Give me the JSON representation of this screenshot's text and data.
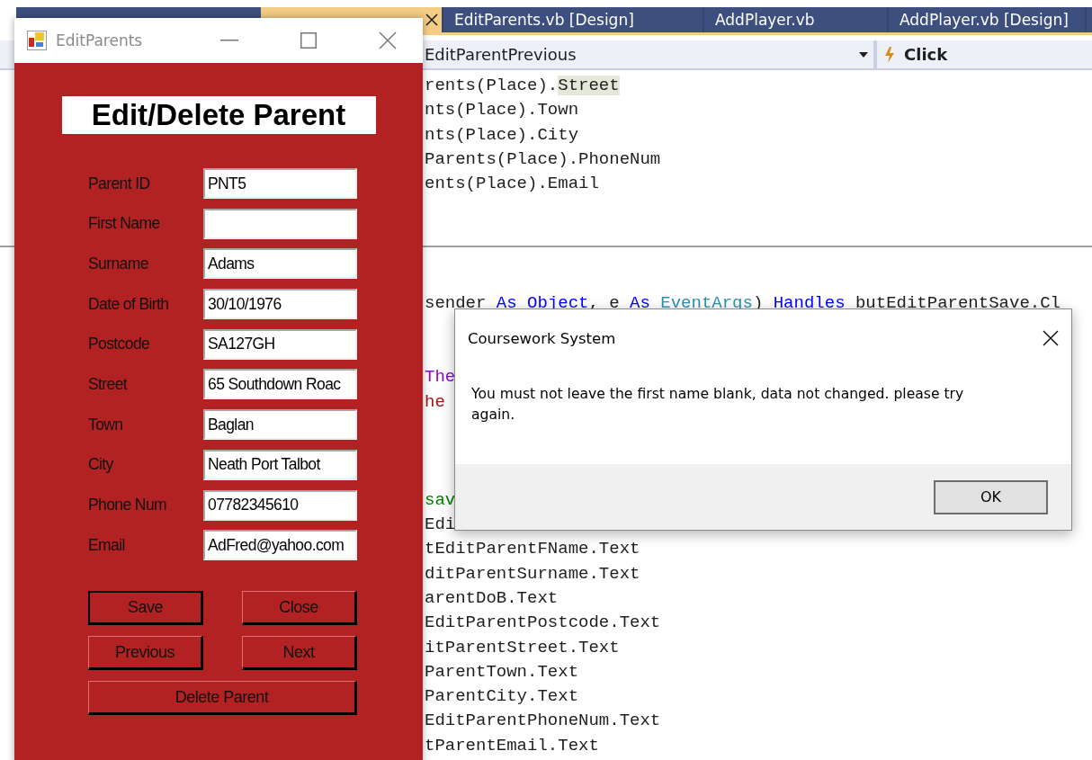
{
  "ide": {
    "tabs": [
      {
        "selected": true
      },
      {
        "label": "EditParents.vb [Design]",
        "selected": false
      },
      {
        "label": "AddPlayer.vb",
        "selected": false
      },
      {
        "label": "AddPlayer.vb [Design]",
        "selected": false
      }
    ],
    "member_dropdown": "EditParentPrevious",
    "event_dropdown": "Click",
    "code_sections": [
      {
        "lines": [
          {
            "kind": "code",
            "tokens": [
              {
                "text": "rents(Place).",
                "kind": "plain"
              },
              {
                "text": "Street",
                "kind": "highlight"
              }
            ]
          },
          {
            "kind": "code",
            "tokens": [
              {
                "text": "nts(Place).Town",
                "kind": "plain"
              }
            ]
          },
          {
            "kind": "code",
            "tokens": [
              {
                "text": "nts(Place).City",
                "kind": "plain"
              }
            ]
          },
          {
            "kind": "code",
            "tokens": [
              {
                "text": "Parents(Place).PhoneNum",
                "kind": "plain"
              }
            ]
          },
          {
            "kind": "code",
            "tokens": [
              {
                "text": "ents(Place).Email",
                "kind": "plain"
              }
            ]
          },
          {
            "kind": "blank"
          },
          {
            "kind": "blank"
          }
        ]
      },
      {
        "lines": [
          {
            "kind": "blank"
          },
          {
            "kind": "code",
            "tokens": [
              {
                "text": "sender ",
                "kind": "plain"
              },
              {
                "text": "As Object",
                "kind": "keyword"
              },
              {
                "text": ", e ",
                "kind": "plain"
              },
              {
                "text": "As ",
                "kind": "keyword"
              },
              {
                "text": "EventArgs",
                "kind": "type"
              },
              {
                "text": ") ",
                "kind": "plain"
              },
              {
                "text": "Handles",
                "kind": "keyword"
              },
              {
                "text": " butEditParentSave.Cl",
                "kind": "plain"
              }
            ]
          },
          {
            "kind": "blank"
          },
          {
            "kind": "blank"
          },
          {
            "kind": "code",
            "tokens": [
              {
                "text": "The",
                "kind": "control"
              }
            ]
          },
          {
            "kind": "code",
            "tokens": [
              {
                "text": "he",
                "kind": "string"
              }
            ]
          },
          {
            "kind": "blank"
          },
          {
            "kind": "blank"
          },
          {
            "kind": "blank"
          },
          {
            "kind": "code",
            "tokens": [
              {
                "text": "sav",
                "kind": "comment"
              }
            ]
          },
          {
            "kind": "code",
            "tokens": [
              {
                "text": "Edi",
                "kind": "plain"
              }
            ]
          },
          {
            "kind": "code",
            "tokens": [
              {
                "text": "tEditParentFName.Text",
                "kind": "plain"
              }
            ]
          },
          {
            "kind": "code",
            "tokens": [
              {
                "text": "ditParentSurname.Text",
                "kind": "plain"
              }
            ]
          },
          {
            "kind": "code",
            "tokens": [
              {
                "text": "arentDoB.Text",
                "kind": "plain"
              }
            ]
          },
          {
            "kind": "code",
            "tokens": [
              {
                "text": "EditParentPostcode.Text",
                "kind": "plain"
              }
            ]
          },
          {
            "kind": "code",
            "tokens": [
              {
                "text": "itParentStreet.Text",
                "kind": "plain"
              }
            ]
          },
          {
            "kind": "code",
            "tokens": [
              {
                "text": "ParentTown.Text",
                "kind": "plain"
              }
            ]
          },
          {
            "kind": "code",
            "tokens": [
              {
                "text": "ParentCity.Text",
                "kind": "plain"
              }
            ]
          },
          {
            "kind": "code",
            "tokens": [
              {
                "text": "EditParentPhoneNum.Text",
                "kind": "plain"
              }
            ]
          },
          {
            "kind": "code",
            "tokens": [
              {
                "text": "tParentEmail.Text",
                "kind": "plain"
              }
            ]
          }
        ]
      }
    ]
  },
  "form_window": {
    "title": "EditParents",
    "heading": "Edit/Delete Parent",
    "fields": [
      {
        "label": "Parent ID",
        "value": "PNT5"
      },
      {
        "label": "First Name"
      },
      {
        "label": "Surname",
        "value": "Adams"
      },
      {
        "label": "Date of Birth",
        "value": "30/10/1976"
      },
      {
        "label": "Postcode",
        "value": "SA127GH"
      },
      {
        "label": "Street",
        "value": "65 Southdown Roac"
      },
      {
        "label": "Town",
        "value": "Baglan"
      },
      {
        "label": "City",
        "value": "Neath Port Talbot"
      },
      {
        "label": "Phone Num",
        "value": "07782345610"
      },
      {
        "label": "Email",
        "value": "AdFred@yahoo.com"
      }
    ],
    "buttons": [
      {
        "label": "Save",
        "focused": true
      },
      {
        "label": "Close",
        "focused": false
      },
      {
        "label": "Previous",
        "focused": false
      },
      {
        "label": "Next",
        "focused": false
      },
      {
        "label": "Delete Parent",
        "focused": false
      }
    ]
  },
  "message_box": {
    "title": "Coursework System",
    "message": "You must not leave the first name blank, data not changed. please try again.",
    "button": "OK"
  }
}
